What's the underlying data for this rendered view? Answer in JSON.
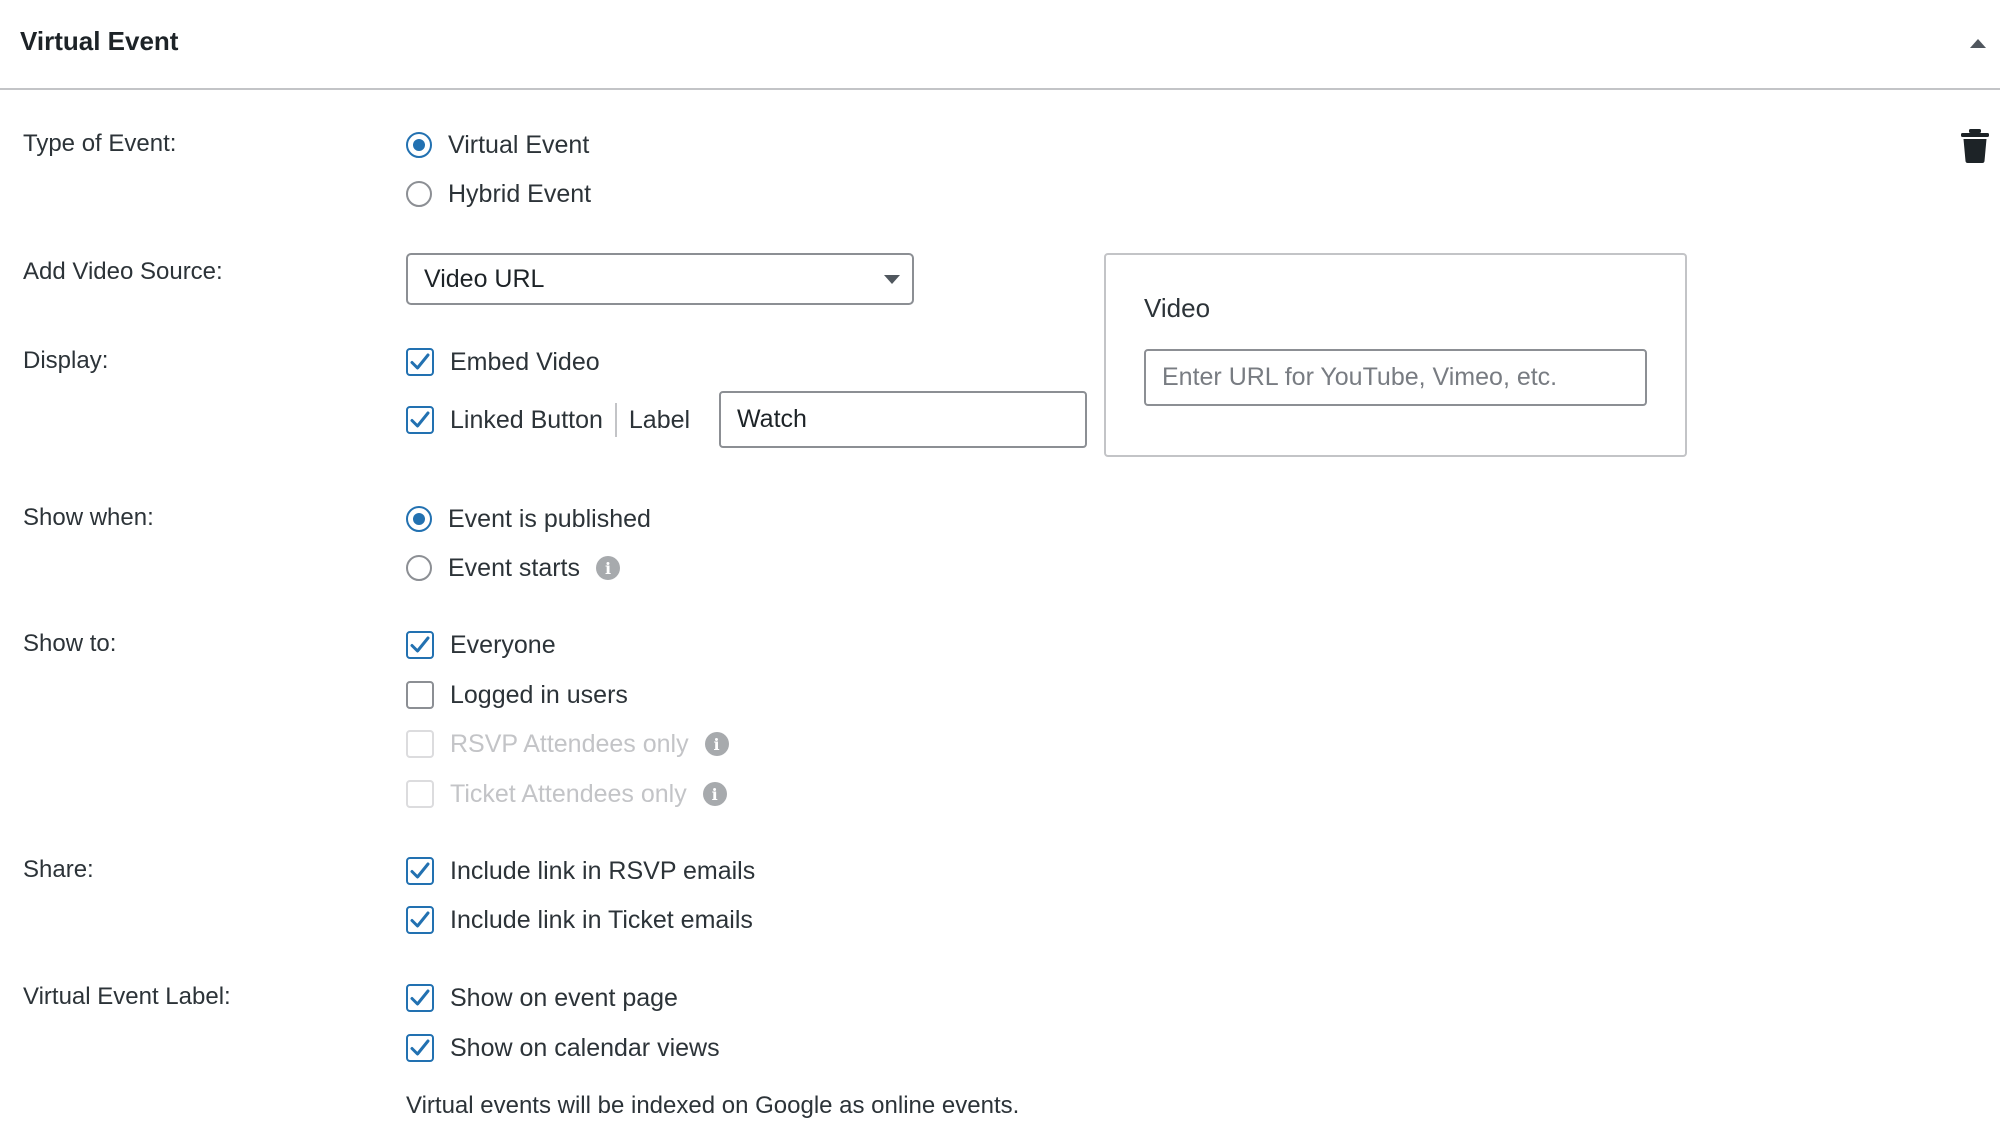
{
  "panel": {
    "title": "Virtual Event"
  },
  "colors": {
    "accent": "#2271b1",
    "border": "#8c8f94",
    "disabled": "#c3c4c7"
  },
  "icons": {
    "collapse": "triangle-up-icon",
    "delete": "trash-icon",
    "info": "info-icon"
  },
  "type_of_event": {
    "label": "Type of Event:",
    "options": [
      {
        "label": "Virtual Event",
        "selected": true
      },
      {
        "label": "Hybrid Event",
        "selected": false
      }
    ]
  },
  "video_source": {
    "label": "Add Video Source:",
    "selected": "Video URL"
  },
  "display": {
    "label": "Display:",
    "embed_video": {
      "label": "Embed Video",
      "checked": true
    },
    "linked_button": {
      "label": "Linked Button",
      "checked": true
    },
    "button_label_caption": "Label",
    "button_label_value": "Watch"
  },
  "video_box": {
    "title": "Video",
    "url_placeholder": "Enter URL for YouTube, Vimeo, etc.",
    "url_value": ""
  },
  "show_when": {
    "label": "Show when:",
    "options": [
      {
        "label": "Event is published",
        "selected": true
      },
      {
        "label": "Event starts",
        "selected": false
      }
    ]
  },
  "show_to": {
    "label": "Show to:",
    "options": [
      {
        "label": "Everyone",
        "checked": true,
        "disabled": false
      },
      {
        "label": "Logged in users",
        "checked": false,
        "disabled": false
      },
      {
        "label": "RSVP Attendees only",
        "checked": false,
        "disabled": true
      },
      {
        "label": "Ticket Attendees only",
        "checked": false,
        "disabled": true
      }
    ]
  },
  "share": {
    "label": "Share:",
    "options": [
      {
        "label": "Include link in RSVP emails",
        "checked": true
      },
      {
        "label": "Include link in Ticket emails",
        "checked": true
      }
    ]
  },
  "virtual_event_label": {
    "label": "Virtual Event Label:",
    "options": [
      {
        "label": "Show on event page",
        "checked": true
      },
      {
        "label": "Show on calendar views",
        "checked": true
      }
    ],
    "note": "Virtual events will be indexed on Google as online events."
  }
}
